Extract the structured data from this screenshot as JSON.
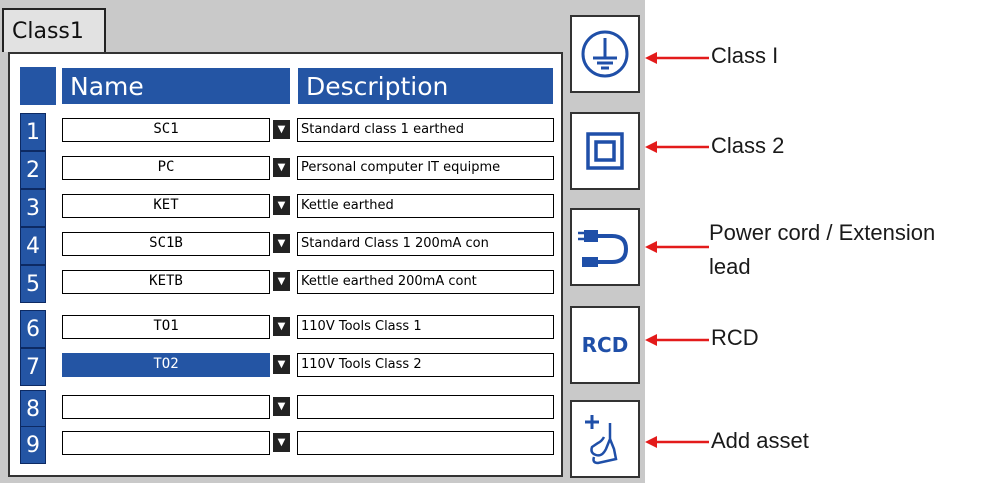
{
  "tab": {
    "label": "Class1"
  },
  "table": {
    "headers": {
      "name": "Name",
      "description": "Description"
    },
    "rows": [
      {
        "num": "1",
        "name": "SC1",
        "description": "Standard class 1 earthed"
      },
      {
        "num": "2",
        "name": "PC",
        "description": "Personal computer IT equipme"
      },
      {
        "num": "3",
        "name": "KET",
        "description": "Kettle earthed"
      },
      {
        "num": "4",
        "name": "SC1B",
        "description": "Standard Class 1 200mA con"
      },
      {
        "num": "5",
        "name": "KETB",
        "description": "Kettle earthed 200mA cont"
      },
      {
        "num": "6",
        "name": "TO1",
        "description": "110V Tools Class 1"
      },
      {
        "num": "7",
        "name": "TO2",
        "description": "110V Tools Class 2",
        "selected": true
      },
      {
        "num": "8",
        "name": "",
        "description": ""
      },
      {
        "num": "9",
        "name": "",
        "description": ""
      }
    ]
  },
  "side_buttons": {
    "class1_icon": "earth-ground-icon",
    "class2_icon": "double-square-icon",
    "cord_icon": "power-cord-icon",
    "rcd_label": "RCD",
    "add_icon": "add-asset-icon"
  },
  "callouts": {
    "class1": "Class I",
    "class2": "Class 2",
    "cord_line1": "Power cord / Extension",
    "cord_line2": "lead",
    "rcd": "RCD",
    "add": "Add asset"
  },
  "colors": {
    "accent": "#2455a4",
    "arrow": "#e31b1b",
    "screen_bg": "#c9c9c9"
  }
}
